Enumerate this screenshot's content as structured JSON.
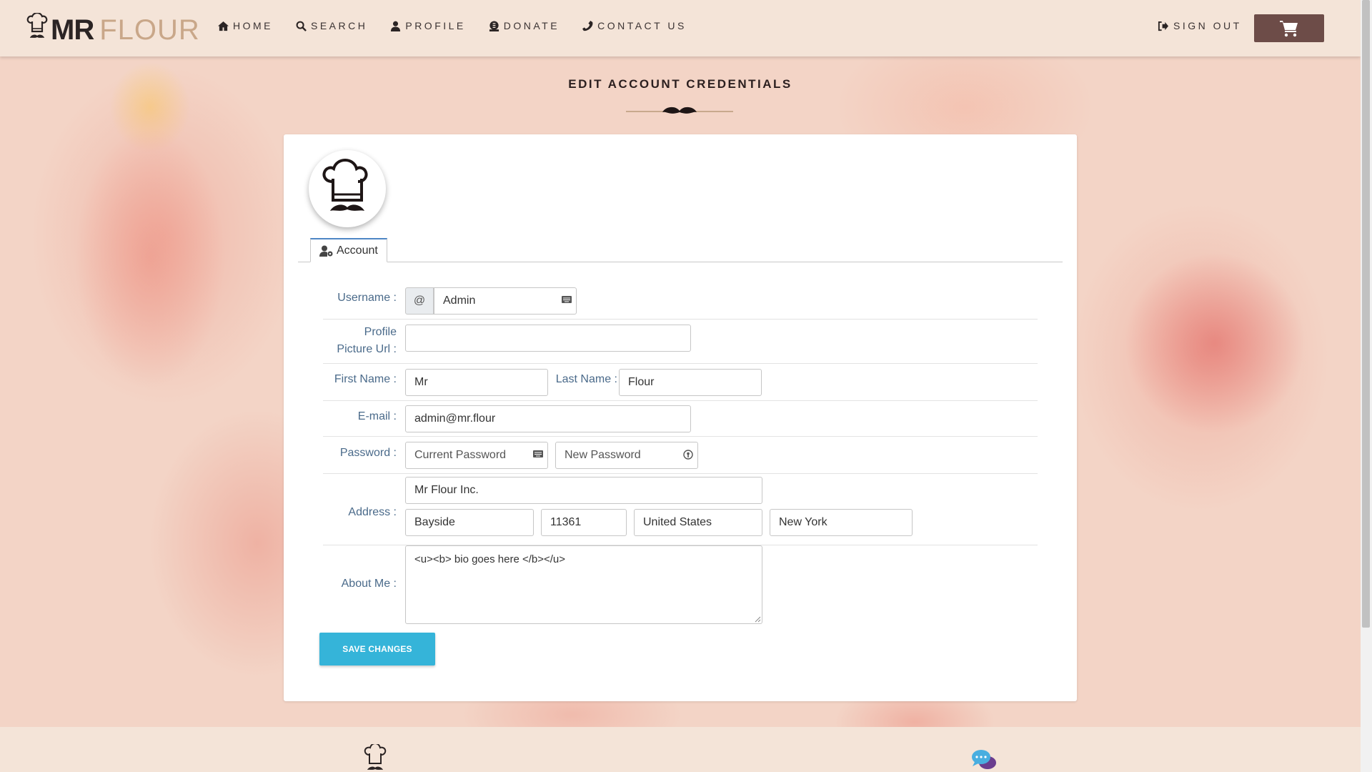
{
  "brand": {
    "name_bold": "MR",
    "name_light": "FLOUR"
  },
  "nav": {
    "items": [
      {
        "label": "HOME",
        "icon": "home-icon"
      },
      {
        "label": "SEARCH",
        "icon": "search-icon"
      },
      {
        "label": "PROFILE",
        "icon": "user-icon"
      },
      {
        "label": "DONATE",
        "icon": "donate-icon"
      },
      {
        "label": "CONTACT US",
        "icon": "phone-icon"
      }
    ],
    "sign_out": "SIGN OUT",
    "cart_icon": "shopping-cart-icon"
  },
  "page": {
    "title": "EDIT ACCOUNT CREDENTIALS"
  },
  "tabs": [
    {
      "label": "Account",
      "icon": "user-cog-icon",
      "active": true
    }
  ],
  "form": {
    "username": {
      "label": "Username :",
      "prefix": "@",
      "value": "Admin"
    },
    "profile_picture": {
      "label_line1": "Profile",
      "label_line2": "Picture Url :",
      "value": ""
    },
    "first_name": {
      "label": "First Name :",
      "value": "Mr"
    },
    "last_name": {
      "label": "Last Name :",
      "value": "Flour"
    },
    "email": {
      "label": "E-mail :",
      "value": "admin@mr.flour"
    },
    "password": {
      "label": "Password :",
      "current_placeholder": "Current Password",
      "new_placeholder": "New Password"
    },
    "address": {
      "label": "Address :",
      "street": "Mr Flour Inc.",
      "city": "Bayside",
      "zip": "11361",
      "country": "United States",
      "state": "New York"
    },
    "about": {
      "label": "About Me :",
      "value": "<u><b> bio goes here </b></u>"
    },
    "save_label": "SAVE CHANGES"
  },
  "colors": {
    "nav_bg": "#f4e4d8",
    "cart_bg": "#6d4c48",
    "save_bg": "#35b4d9",
    "label": "#4a6a8a",
    "tab_accent": "#4e86c5"
  }
}
